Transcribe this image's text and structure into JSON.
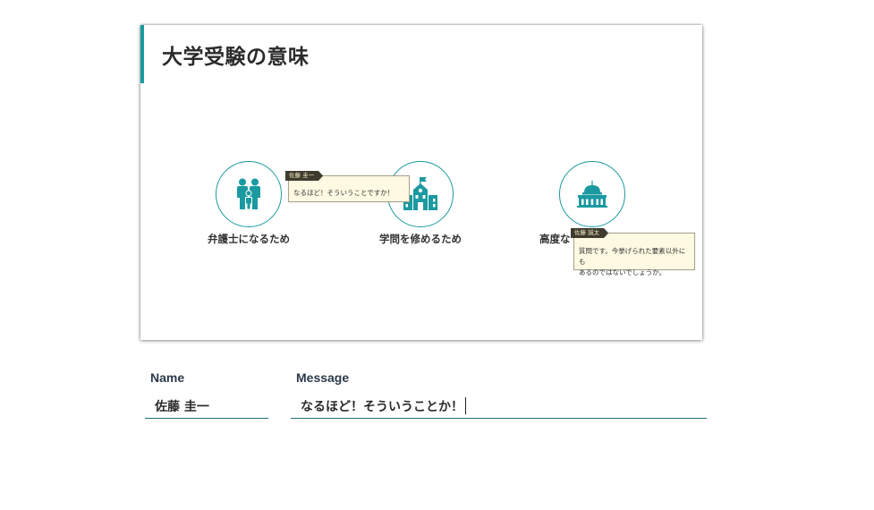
{
  "slide": {
    "title": "大学受験の意味",
    "items": [
      {
        "label": "弁護士になるため",
        "icon": "family-icon"
      },
      {
        "label": "学問を修めるため",
        "icon": "school-building-icon"
      },
      {
        "label": "高度な",
        "icon": "capitol-building-icon"
      }
    ],
    "comments": [
      {
        "author": "佐藤 圭一",
        "text": "なるほど！そういうことですか！"
      },
      {
        "author": "佐藤 誠太",
        "text_line1": "質問です。今挙げられた要素以外にも",
        "text_line2": "あるのではないでしょうか。"
      }
    ]
  },
  "form": {
    "name_label": "Name",
    "name_value": "佐藤 圭一",
    "message_label": "Message",
    "message_value": "なるほど！そういうことか！"
  },
  "colors": {
    "accent": "#1a9aa0",
    "comment_bg": "#fdf9e2",
    "tag_bg": "#3f3b2d"
  }
}
